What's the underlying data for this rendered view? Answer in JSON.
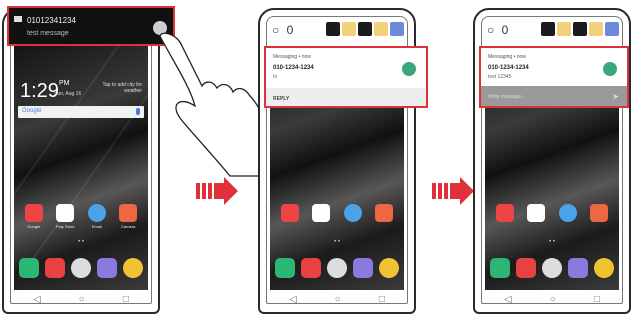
{
  "phone1": {
    "notification": {
      "number": "01012341234",
      "message": "test message"
    },
    "clock": {
      "time": "1:29",
      "ampm": "PM",
      "date": "Sun, Aug 16"
    },
    "weather": "Tap to add city for weather",
    "search_label": "Google",
    "apps": [
      "Google",
      "Play Store",
      "Email",
      "Camera"
    ],
    "dock_icons": [
      "phone-icon",
      "messages-icon",
      "camera-app-icon",
      "gallery-icon",
      "chrome-icon"
    ]
  },
  "phone2": {
    "notification": {
      "app": "Messaging • now",
      "number": "010-1234-1234",
      "message": "hi",
      "action": "REPLY"
    }
  },
  "phone3": {
    "notification": {
      "app": "Messaging • now",
      "number": "010-1234-1234",
      "message": "test 12345",
      "reply_placeholder": "Write message..."
    }
  },
  "nav_glyphs": {
    "back": "◁",
    "home": "○",
    "recent": "□"
  },
  "camera_glyph": "○ 0",
  "accent_color": "#e0303a"
}
